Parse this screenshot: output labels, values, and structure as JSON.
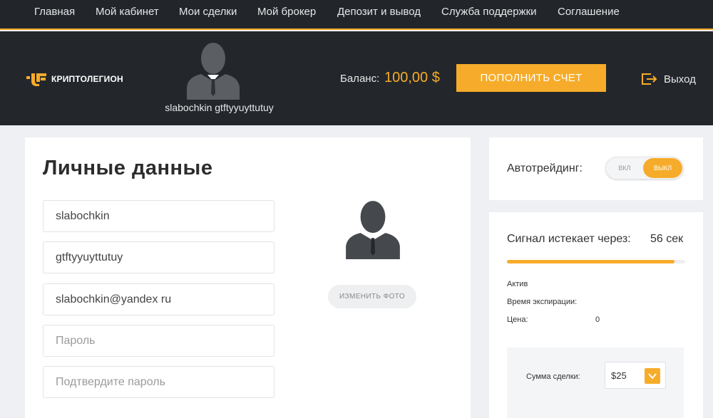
{
  "nav": {
    "items": [
      {
        "label": "Главная"
      },
      {
        "label": "Мой кабинет"
      },
      {
        "label": "Мои сделки"
      },
      {
        "label": "Мой брокер"
      },
      {
        "label": "Депозит и вывод"
      },
      {
        "label": "Служба поддержки"
      },
      {
        "label": "Соглашение"
      }
    ]
  },
  "header": {
    "logo_text": "КРИПТОЛЕГИОН",
    "username": "slabochkin gtftyyuyttutuy",
    "balance_label": "Баланс:",
    "balance_value": "100,00 $",
    "topup_label": "ПОПОЛНИТЬ СЧЕТ",
    "logout_label": "Выход"
  },
  "profile": {
    "title": "Личные данные",
    "fields": {
      "first_name": "slabochkin",
      "last_name": "gtftyyuyttutuy",
      "email": "slabochkin@yandex ru",
      "password_placeholder": "Пароль",
      "confirm_placeholder": "Подтвердите пароль"
    },
    "change_photo_label": "ИЗМЕНИТЬ ФОТО"
  },
  "autotrading": {
    "label": "Автотрейдинг:",
    "on_label": "ВКЛ",
    "off_label": "ВЫКЛ",
    "active": "off"
  },
  "signal": {
    "label": "Сигнал истекает через:",
    "value": "56 сек",
    "progress": 0.94,
    "asset_label": "Актив",
    "expiration_label": "Время экспирации:",
    "price_label": "Цена:",
    "price_value": "0"
  },
  "deal": {
    "amount_label": "Сумма сделки:",
    "amount_value": "$25"
  },
  "colors": {
    "accent": "#f6ac2a",
    "dark": "#23272c",
    "background": "#eef0f3"
  }
}
